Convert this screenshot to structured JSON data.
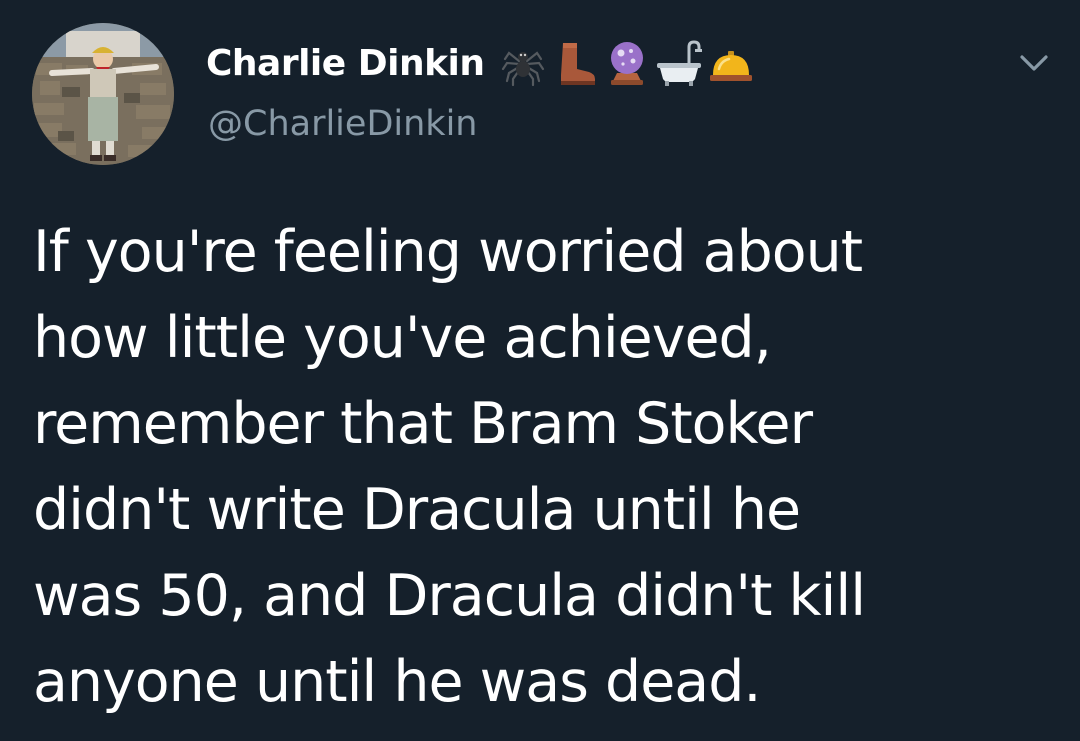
{
  "tweet": {
    "author": {
      "display_name": "Charlie Dinkin",
      "handle": "@CharlieDinkin",
      "avatar": "avatar-photo",
      "name_emojis": [
        "spider-icon",
        "boot-icon",
        "crystal-ball-icon",
        "bathtub-icon",
        "bellhop-bell-icon"
      ]
    },
    "menu_icon": "chevron-down-icon",
    "text": "If you're feeling worried about\nhow little you've achieved,\nremember that Bram Stoker\ndidn't write Dracula until he\nwas 50, and Dracula didn't kill\nanyone until he was dead."
  },
  "colors": {
    "background": "#15202b",
    "primary_text": "#ffffff",
    "secondary_text": "#8899a6"
  }
}
